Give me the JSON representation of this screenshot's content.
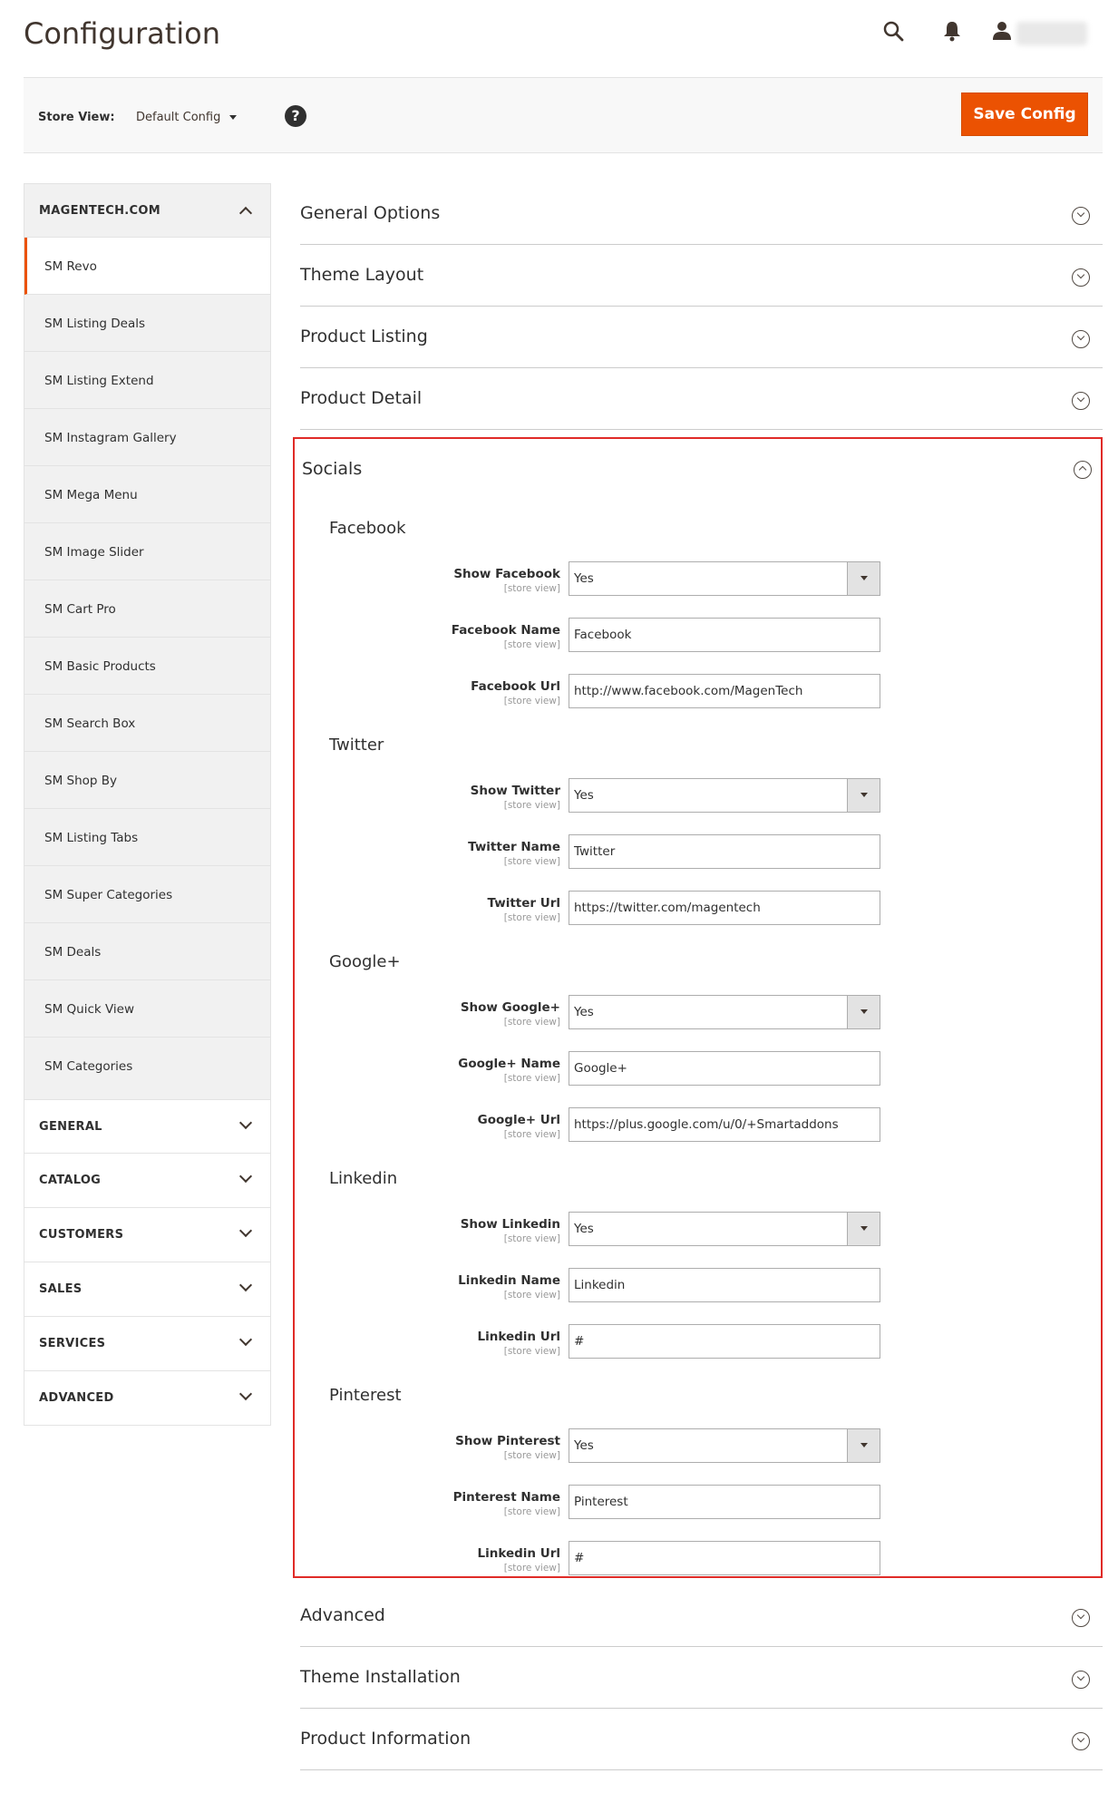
{
  "header": {
    "title": "Configuration"
  },
  "toolbar": {
    "store_label": "Store View:",
    "store_value": "Default Config",
    "help": "?",
    "save_label": "Save Config"
  },
  "sidebar": {
    "group_title": "MAGENTECH.COM",
    "items": [
      {
        "label": "SM Revo"
      },
      {
        "label": "SM Listing Deals"
      },
      {
        "label": "SM Listing Extend"
      },
      {
        "label": "SM Instagram Gallery"
      },
      {
        "label": "SM Mega Menu"
      },
      {
        "label": "SM Image Slider"
      },
      {
        "label": "SM Cart Pro"
      },
      {
        "label": "SM Basic Products"
      },
      {
        "label": "SM Search Box"
      },
      {
        "label": "SM Shop By"
      },
      {
        "label": "SM Listing Tabs"
      },
      {
        "label": "SM Super Categories"
      },
      {
        "label": "SM Deals"
      },
      {
        "label": "SM Quick View"
      },
      {
        "label": "SM Categories"
      }
    ],
    "groups": [
      "GENERAL",
      "CATALOG",
      "CUSTOMERS",
      "SALES",
      "SERVICES",
      "ADVANCED"
    ]
  },
  "sections_top": [
    "General Options",
    "Theme Layout",
    "Product Listing",
    "Product Detail"
  ],
  "socials": {
    "title": "Socials",
    "scope": "[store view]",
    "groups": [
      {
        "title": "Facebook",
        "fields": [
          {
            "label": "Show Facebook",
            "value": "Yes",
            "type": "select"
          },
          {
            "label": "Facebook Name",
            "value": "Facebook",
            "type": "text"
          },
          {
            "label": "Facebook Url",
            "value": "http://www.facebook.com/MagenTech",
            "type": "text"
          }
        ]
      },
      {
        "title": "Twitter",
        "fields": [
          {
            "label": "Show Twitter",
            "value": "Yes",
            "type": "select"
          },
          {
            "label": "Twitter Name",
            "value": "Twitter",
            "type": "text"
          },
          {
            "label": "Twitter Url",
            "value": "https://twitter.com/magentech",
            "type": "text"
          }
        ]
      },
      {
        "title": "Google+",
        "fields": [
          {
            "label": "Show Google+",
            "value": "Yes",
            "type": "select"
          },
          {
            "label": "Google+ Name",
            "value": "Google+",
            "type": "text"
          },
          {
            "label": "Google+ Url",
            "value": "https://plus.google.com/u/0/+Smartaddons",
            "type": "text"
          }
        ]
      },
      {
        "title": "Linkedin",
        "fields": [
          {
            "label": "Show Linkedin",
            "value": "Yes",
            "type": "select"
          },
          {
            "label": "Linkedin Name",
            "value": "Linkedin",
            "type": "text"
          },
          {
            "label": "Linkedin Url",
            "value": "#",
            "type": "text"
          }
        ]
      },
      {
        "title": "Pinterest",
        "fields": [
          {
            "label": "Show Pinterest",
            "value": "Yes",
            "type": "select"
          },
          {
            "label": "Pinterest Name",
            "value": "Pinterest",
            "type": "text"
          },
          {
            "label": "Linkedin Url",
            "value": "#",
            "type": "text"
          }
        ]
      }
    ]
  },
  "sections_bottom": [
    "Advanced",
    "Theme Installation",
    "Product Information"
  ],
  "colors": {
    "accent": "#eb5202",
    "highlight": "#e02b27"
  }
}
